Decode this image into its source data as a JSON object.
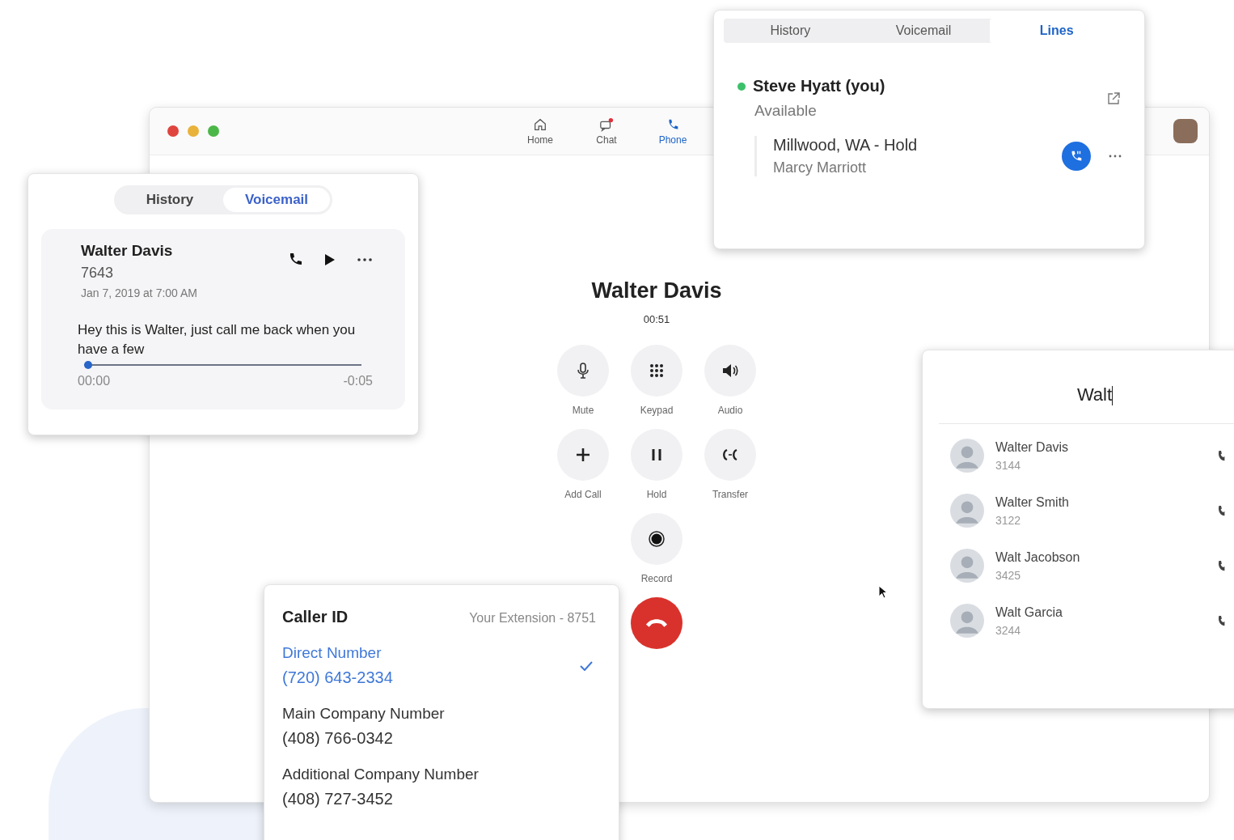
{
  "window": {
    "nav": [
      {
        "label": "Home",
        "kind": "home",
        "selected": false,
        "badge": false
      },
      {
        "label": "Chat",
        "kind": "chat",
        "selected": false,
        "badge": true
      },
      {
        "label": "Phone",
        "kind": "phone",
        "selected": true,
        "badge": false
      }
    ]
  },
  "call": {
    "name": "Walter Davis",
    "timer": "00:51",
    "actions": [
      {
        "label": "Mute",
        "kind": "mute"
      },
      {
        "label": "Keypad",
        "kind": "keypad"
      },
      {
        "label": "Audio",
        "kind": "audio"
      },
      {
        "label": "Add Call",
        "kind": "add"
      },
      {
        "label": "Hold",
        "kind": "hold"
      },
      {
        "label": "Transfer",
        "kind": "transfer"
      },
      {
        "label": "Record",
        "kind": "record"
      }
    ]
  },
  "voicemail_panel": {
    "tabs": [
      {
        "label": "History",
        "selected": false
      },
      {
        "label": "Voicemail",
        "selected": true
      }
    ],
    "message": {
      "name": "Walter Davis",
      "extension": "7643",
      "date": "Jan 7, 2019 at 7:00 AM",
      "transcript": "Hey this is Walter, just call me back when you have a few",
      "level": 0,
      "elapsed": "00:00",
      "remaining": "-0:05"
    }
  },
  "lines_panel": {
    "tabs": [
      {
        "label": "History",
        "selected": false
      },
      {
        "label": "Voicemail",
        "selected": false
      },
      {
        "label": "Lines",
        "selected": true
      }
    ],
    "user": {
      "name": "Steve Hyatt (you)",
      "status": "Available",
      "online": true
    },
    "line": {
      "title": "Millwood, WA - Hold",
      "caller": "Marcy Marriott"
    }
  },
  "contacts_panel": {
    "search": "Walt",
    "results": [
      {
        "name": "Walter Davis",
        "extension": "3144"
      },
      {
        "name": "Walter Smith",
        "extension": "3122"
      },
      {
        "name": "Walt Jacobson",
        "extension": "3425"
      },
      {
        "name": "Walt Garcia",
        "extension": "3244"
      }
    ]
  },
  "caller_id_panel": {
    "title": "Caller ID",
    "extension": "Your Extension - 8751",
    "options": [
      {
        "label": "Direct Number",
        "number": "(720) 643-2334",
        "selected": true
      },
      {
        "label": "Main Company Number",
        "number": "(408) 766-0342",
        "selected": false
      },
      {
        "label": "Additional Company Number",
        "number": "(408) 727-3452",
        "selected": false
      }
    ]
  }
}
